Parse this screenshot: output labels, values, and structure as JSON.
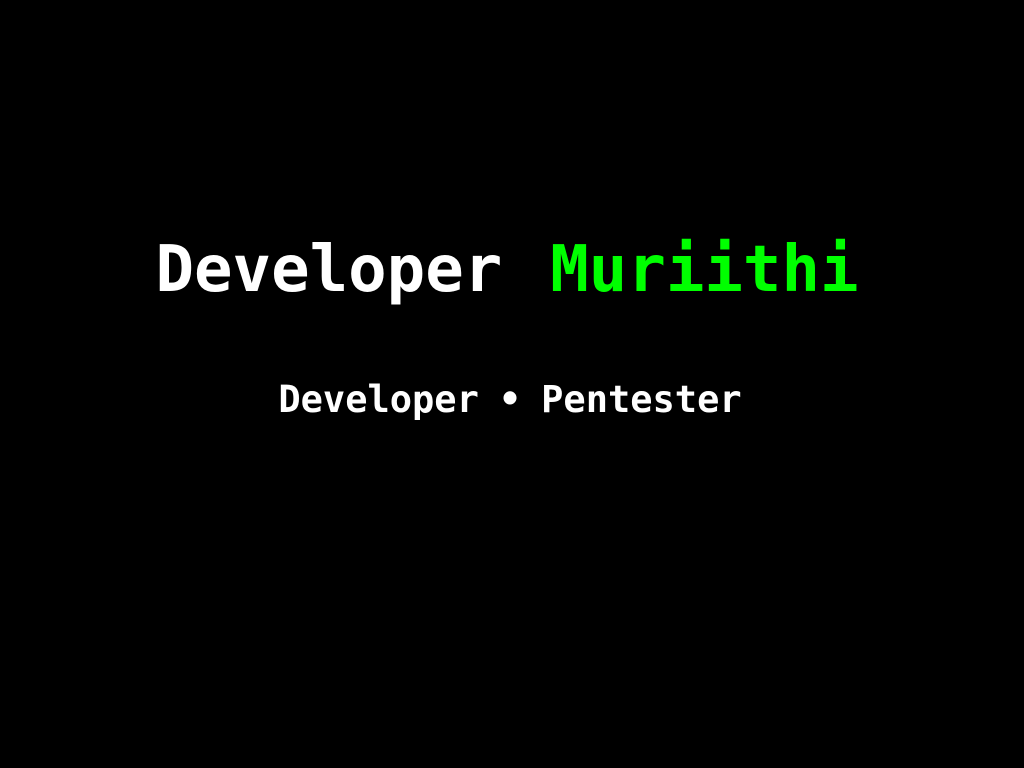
{
  "hero": {
    "title_prefix": "Developer",
    "title_name": "Muriithi",
    "roles": [
      "Developer",
      "Pentester"
    ],
    "separator": "•"
  },
  "colors": {
    "background": "#000000",
    "text": "#ffffff",
    "accent": "#00ff00"
  }
}
